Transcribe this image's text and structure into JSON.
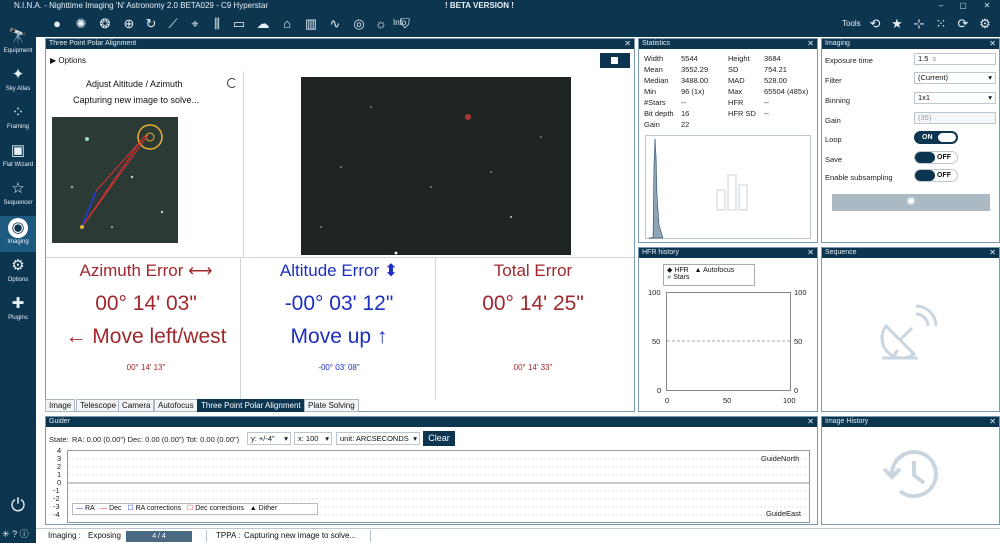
{
  "window": {
    "title": "N.I.N.A. - Nighttime Imaging 'N' Astronomy 2.0 BETA029  -  C9 Hyperstar",
    "beta": "! BETA VERSION !",
    "minimize": "–",
    "maximize": "▢",
    "close": "✕"
  },
  "nav": [
    {
      "label": "Equipment",
      "icon": "telescope-icon"
    },
    {
      "label": "Sky Atlas",
      "icon": "sky-atlas-icon"
    },
    {
      "label": "Framing",
      "icon": "framing-icon"
    },
    {
      "label": "Flat Wizard",
      "icon": "flat-wizard-icon"
    },
    {
      "label": "Sequencer",
      "icon": "sequencer-icon"
    },
    {
      "label": "Imaging",
      "icon": "imaging-icon"
    },
    {
      "label": "Options",
      "icon": "gear-icon"
    },
    {
      "label": "Plugins",
      "icon": "puzzle-icon"
    }
  ],
  "toolbar": {
    "info": "Info",
    "tools": "Tools"
  },
  "tppa": {
    "header": "Three Point Polar Alignment",
    "options": "Options",
    "step_title": "Adjust Altitude / Azimuth",
    "step_status": "Capturing new image to solve...",
    "azimuth": {
      "title": "Azimuth Error ⟷",
      "value": "00° 14' 03\"",
      "direction": "← Move left/west",
      "sub": "00° 14' 13\""
    },
    "altitude": {
      "title": "Altitude Error ⬍",
      "value": "-00° 03' 12\"",
      "direction": "Move up ↑",
      "sub": "-00° 03' 08\""
    },
    "total": {
      "title": "Total Error",
      "value": "00° 14' 25\"",
      "sub": "00° 14' 33\""
    }
  },
  "tabs": [
    "Image",
    "Telescope",
    "Camera",
    "Autofocus",
    "Three Point Polar Alignment",
    "Plate Solving"
  ],
  "statistics": {
    "header": "Statistics",
    "left": [
      [
        "Width",
        "5544"
      ],
      [
        "Mean",
        "3552.29"
      ],
      [
        "Median",
        "3488.00"
      ],
      [
        "Min",
        "96 (1x)"
      ],
      [
        "#Stars",
        "--"
      ],
      [
        "Bit depth",
        "16"
      ],
      [
        "Gain",
        "22"
      ]
    ],
    "right": [
      [
        "Height",
        "3684"
      ],
      [
        "SD",
        "754.21"
      ],
      [
        "MAD",
        "528.00"
      ],
      [
        "Max",
        "65504 (485x)"
      ],
      [
        "HFR",
        "--"
      ],
      [
        "HFR SD",
        "--"
      ]
    ]
  },
  "imaging": {
    "header": "Imaging",
    "exposure_label": "Exposure time",
    "exposure_value": "1.5",
    "exposure_unit": "s",
    "filter_label": "Filter",
    "filter_value": "(Current)",
    "binning_label": "Binning",
    "binning_value": "1x1",
    "gain_label": "Gain",
    "gain_value": "(35)",
    "loop_label": "Loop",
    "loop_state": "ON",
    "save_label": "Save",
    "save_state": "OFF",
    "subsampling_label": "Enable subsampling",
    "subsampling_state": "OFF"
  },
  "hfr": {
    "header": "HFR history",
    "legend": [
      "HFR",
      "Autofocus",
      "Stars"
    ],
    "y_ticks": [
      "100",
      "50",
      "0"
    ],
    "x_ticks": [
      "0",
      "50",
      "100"
    ],
    "y2_ticks": [
      "100",
      "50",
      "0"
    ]
  },
  "sequence": {
    "header": "Sequence"
  },
  "guider": {
    "header": "Guider",
    "state_label": "State:",
    "stats": "RA: 0.00 (0.00\")  Dec: 0.00 (0.00\")  Tot: 0.00 (0.00\")",
    "y_scale": "y: +/-4\"",
    "x_scale": "x: 100",
    "unit": "unit: ARCSECONDS",
    "clear": "Clear",
    "y_ticks": [
      "4",
      "3",
      "2",
      "1",
      "0",
      "-1",
      "-2",
      "-3",
      "-4"
    ],
    "north": "GuideNorth",
    "east": "GuideEast",
    "legend": [
      "RA",
      "Dec",
      "RA corrections",
      "Dec corrections",
      "Dither"
    ]
  },
  "image_history": {
    "header": "Image History"
  },
  "status": {
    "imaging": "Imaging :",
    "exposing": "Exposing",
    "progress": "4 / 4",
    "progress_fraction": 1.0,
    "tppa_label": "TPPA :",
    "tppa_status": "Capturing new image to solve..."
  },
  "colors": {
    "nav_bg": "#0c3550",
    "azimuth": "#a0282d",
    "altitude": "#1c2fc0",
    "total": "#a0282d"
  }
}
